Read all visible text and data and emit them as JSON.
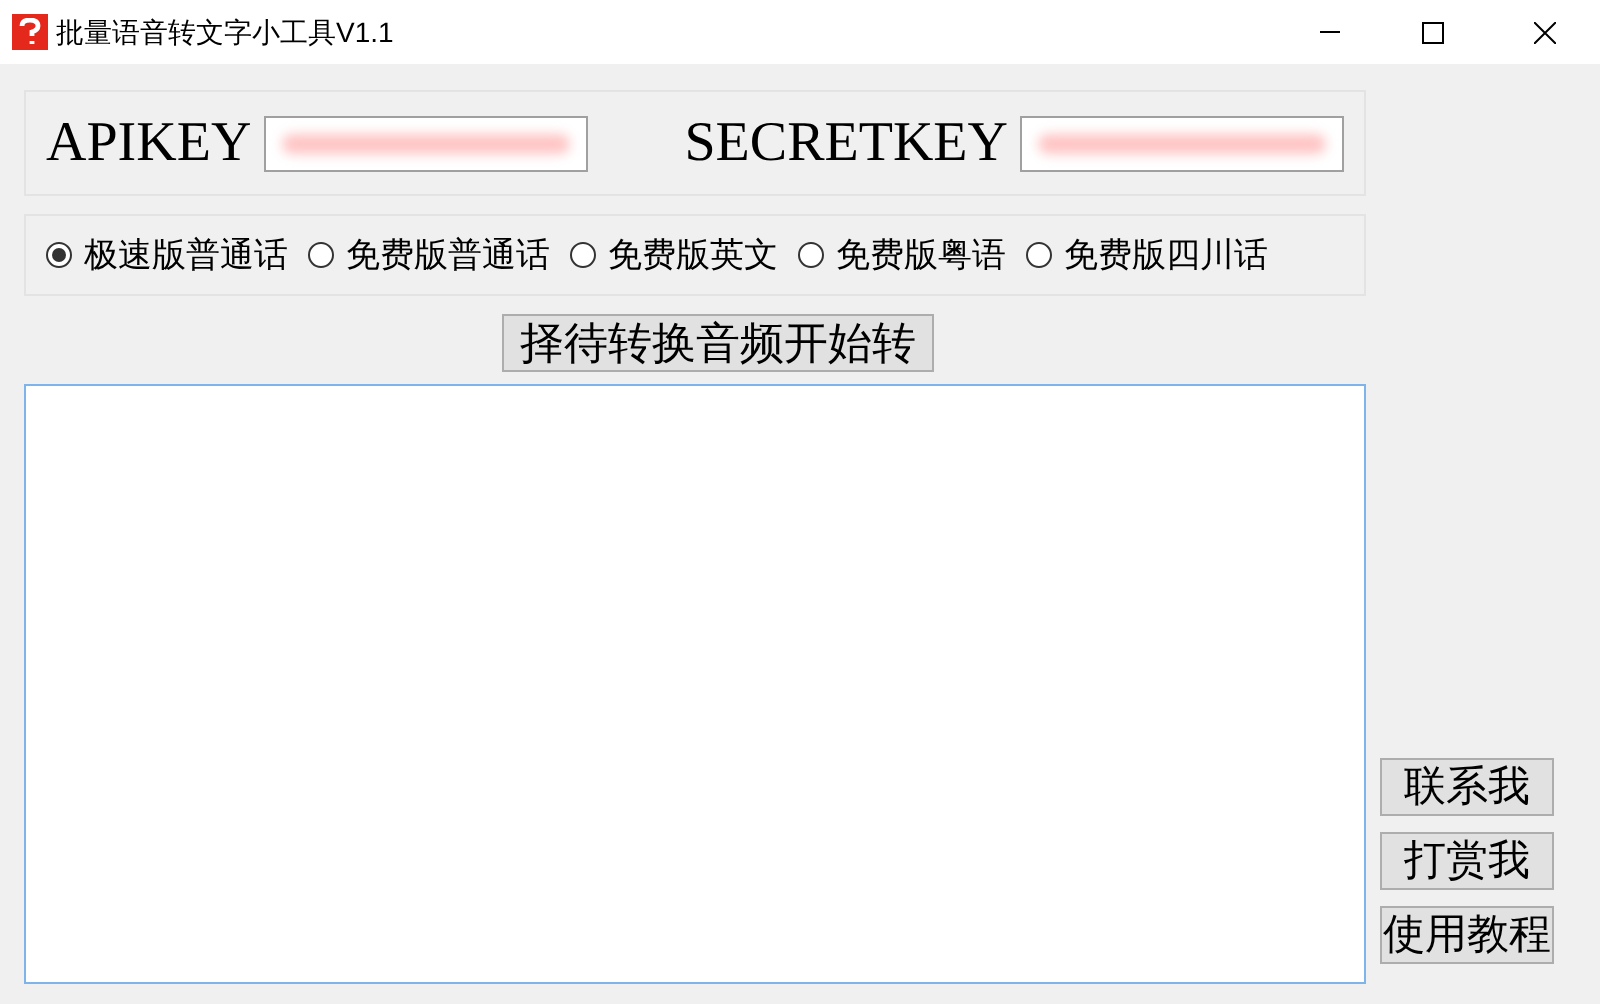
{
  "window": {
    "title": "批量语音转文字小工具V1.1"
  },
  "keys": [
    {
      "label": "APIKEY"
    },
    {
      "label": "SECRETKEY"
    }
  ],
  "modes": [
    {
      "label": "极速版普通话",
      "selected": true
    },
    {
      "label": "免费版普通话",
      "selected": false
    },
    {
      "label": "免费版英文",
      "selected": false
    },
    {
      "label": "免费版粤语",
      "selected": false
    },
    {
      "label": "免费版四川话",
      "selected": false
    }
  ],
  "select_button": "择待转换音频开始转",
  "side_buttons": [
    "联系我",
    "打赏我",
    "使用教程"
  ]
}
